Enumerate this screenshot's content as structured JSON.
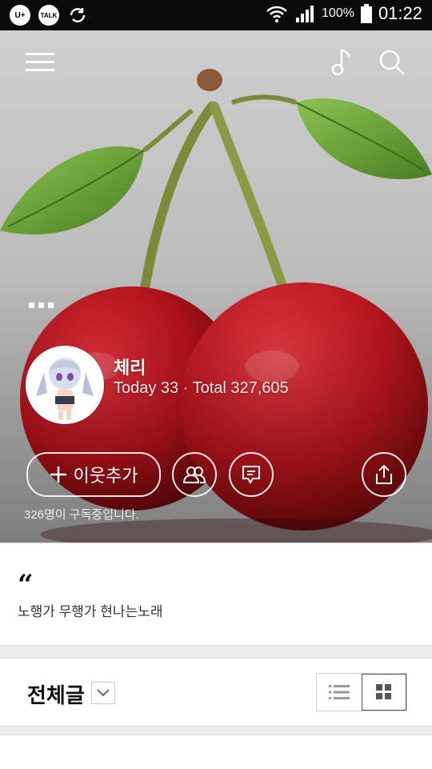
{
  "status_bar": {
    "battery": "100%",
    "time": "01:22",
    "app_badges": [
      "U+",
      "TALK"
    ]
  },
  "profile": {
    "name": "체리",
    "stats": "Today 33 · Total 327,605",
    "add_neighbor_label": "이웃추가",
    "subscribers": "326명이 구독중입니다."
  },
  "intro": {
    "quote_mark": "“",
    "text": "노행가 무행가 현나는노래"
  },
  "posts": {
    "title": "전체글"
  },
  "colors": {
    "cherry_red": "#b3121b",
    "leaf_green": "#6da33a",
    "status_bar": "#0b0b0b"
  }
}
